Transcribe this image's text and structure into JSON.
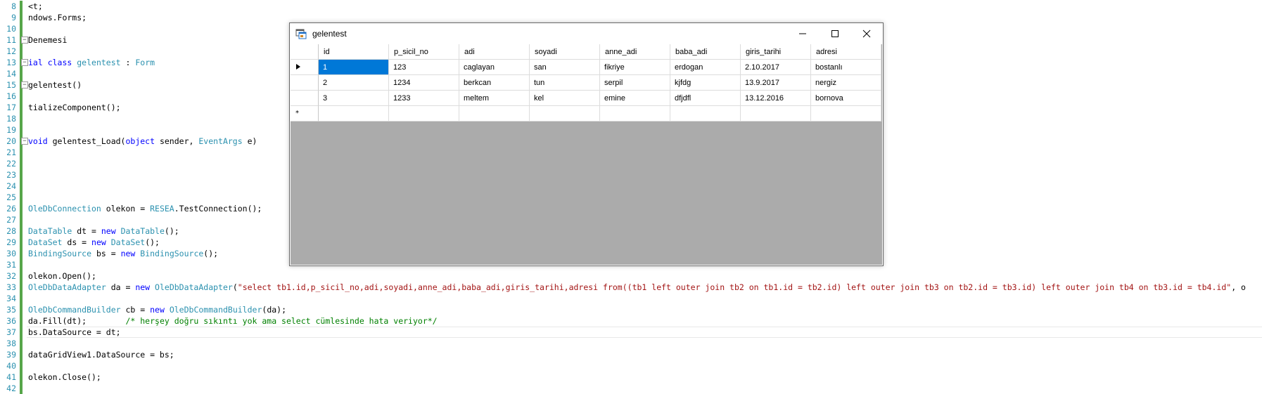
{
  "editor": {
    "lines": [
      {
        "n": "8",
        "html": "<span>&lt;t;</span>"
      },
      {
        "n": "9",
        "html": "<span>ndows.Forms;</span>"
      },
      {
        "n": "10",
        "html": ""
      },
      {
        "n": "11",
        "html": "<span>Denemesi</span>"
      },
      {
        "n": "12",
        "html": ""
      },
      {
        "n": "13",
        "html": "<span class=\"kw\">ial class</span> <span class=\"ty\">gelentest</span> : <span class=\"ty\">Form</span>"
      },
      {
        "n": "14",
        "html": ""
      },
      {
        "n": "15",
        "html": "<span>gelentest()</span>"
      },
      {
        "n": "16",
        "html": ""
      },
      {
        "n": "17",
        "html": "<span>tializeComponent();</span>"
      },
      {
        "n": "18",
        "html": ""
      },
      {
        "n": "19",
        "html": ""
      },
      {
        "n": "20",
        "html": "<span class=\"kw\">void</span> gelentest_Load(<span class=\"kw\">object</span> sender, <span class=\"ty\">EventArgs</span> e)"
      },
      {
        "n": "21",
        "html": ""
      },
      {
        "n": "22",
        "html": ""
      },
      {
        "n": "23",
        "html": ""
      },
      {
        "n": "24",
        "html": ""
      },
      {
        "n": "25",
        "html": ""
      },
      {
        "n": "26",
        "html": "<span class=\"ty\">OleDbConnection</span> olekon = <span class=\"ty\">RESEA</span>.TestConnection();"
      },
      {
        "n": "27",
        "html": ""
      },
      {
        "n": "28",
        "html": "<span class=\"ty\">DataTable</span> dt = <span class=\"kw\">new</span> <span class=\"ty\">DataTable</span>();"
      },
      {
        "n": "29",
        "html": "<span class=\"ty\">DataSet</span> ds = <span class=\"kw\">new</span> <span class=\"ty\">DataSet</span>();"
      },
      {
        "n": "30",
        "html": "<span class=\"ty\">BindingSource</span> bs = <span class=\"kw\">new</span> <span class=\"ty\">BindingSource</span>();"
      },
      {
        "n": "31",
        "html": ""
      },
      {
        "n": "32",
        "html": "olekon.Open();"
      },
      {
        "n": "33",
        "html": "<span class=\"ty\">OleDbDataAdapter</span> da = <span class=\"kw\">new</span> <span class=\"ty\">OleDbDataAdapter</span>(<span class=\"st\">\"select tb1.id,p_sicil_no,adi,soyadi,anne_adi,baba_adi,giris_tarihi,adresi from((tb1 left outer join tb2 on tb1.id = tb2.id) left outer join tb3 on tb2.id = tb3.id) left outer join tb4 on tb3.id = tb4.id\"</span>, o"
      },
      {
        "n": "34",
        "html": ""
      },
      {
        "n": "35",
        "html": "<span class=\"ty\">OleDbCommandBuilder</span> cb = <span class=\"kw\">new</span> <span class=\"ty\">OleDbCommandBuilder</span>(da);"
      },
      {
        "n": "36",
        "html": "da.Fill(dt);        <span class=\"cm\">/* herşey doğru sıkıntı yok ama select cümlesinde hata veriyor*/</span>"
      },
      {
        "n": "37",
        "html": "bs.DataSource = dt;"
      },
      {
        "n": "38",
        "html": ""
      },
      {
        "n": "39",
        "html": "dataGridView1.DataSource = bs;"
      },
      {
        "n": "40",
        "html": ""
      },
      {
        "n": "41",
        "html": "olekon.Close();"
      },
      {
        "n": "42",
        "html": ""
      }
    ]
  },
  "window": {
    "title": "gelentest"
  },
  "grid": {
    "columns": [
      "id",
      "p_sicil_no",
      "adi",
      "soyadi",
      "anne_adi",
      "baba_adi",
      "giris_tarihi",
      "adresi"
    ],
    "rows": [
      [
        "1",
        "123",
        "caglayan",
        "san",
        "fikriye",
        "erdogan",
        "2.10.2017",
        "bostanlı"
      ],
      [
        "2",
        "1234",
        "berkcan",
        "tun",
        "serpil",
        "kjfdg",
        "13.9.2017",
        "nergiz"
      ],
      [
        "3",
        "1233",
        "meltem",
        "kel",
        "emine",
        "dfjdfl",
        "13.12.2016",
        "bornova"
      ]
    ],
    "new_row_marker": "*",
    "current_row_marker": "▸"
  }
}
